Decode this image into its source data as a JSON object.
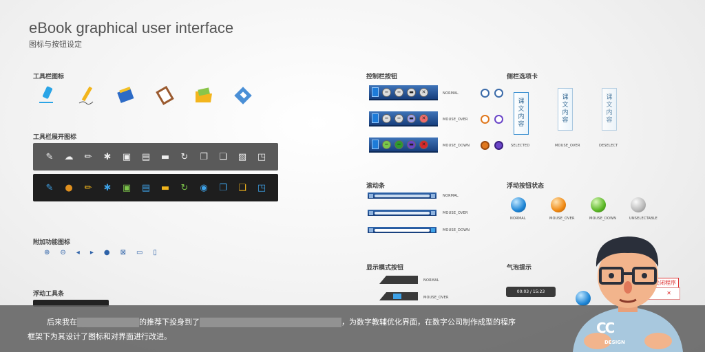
{
  "header": {
    "title": "eBook graphical user interface",
    "subtitle": "图标与按钮设定"
  },
  "sections": {
    "toolbar_icons": "工具栏图标",
    "toolbar_expand": "工具栏展开图标",
    "extra_icons": "附加功能图标",
    "float_toolbar": "浮动工具条",
    "control_buttons": "控制栏按钮",
    "sidebar_tabs": "侧栏选项卡",
    "scrollbar": "滚动条",
    "float_button_states": "浮动按钮状态",
    "display_mode": "显示模式按钮",
    "bubble": "气泡提示"
  },
  "states": {
    "normal": "NORMAL",
    "mouse_over": "MOUSE_OVER",
    "mouse_down": "MOUSE_DOWN",
    "selected": "SELECTED",
    "deselect": "DESELECT",
    "unselectable": "UNSELECTABLE"
  },
  "tab_text": [
    "课",
    "文",
    "内",
    "容"
  ],
  "bubble": {
    "time": "00:03 / 15:23",
    "close_tip": "关闭程序"
  },
  "caption": {
    "line1_a": "后来我在",
    "line1_b": "的推荐下投身到了",
    "line1_c": "，为数字教辅优化界面，在数字公司制作成型的程序",
    "line2": "框架下为其设计了图标和对界面进行改进。"
  },
  "badge": {
    "logo": "CC",
    "text": "DESIGN"
  },
  "colors": {
    "accent": "#1d7bd8",
    "dark_bar": "#1e1e1e",
    "gray_bar": "#5a5a5a"
  }
}
